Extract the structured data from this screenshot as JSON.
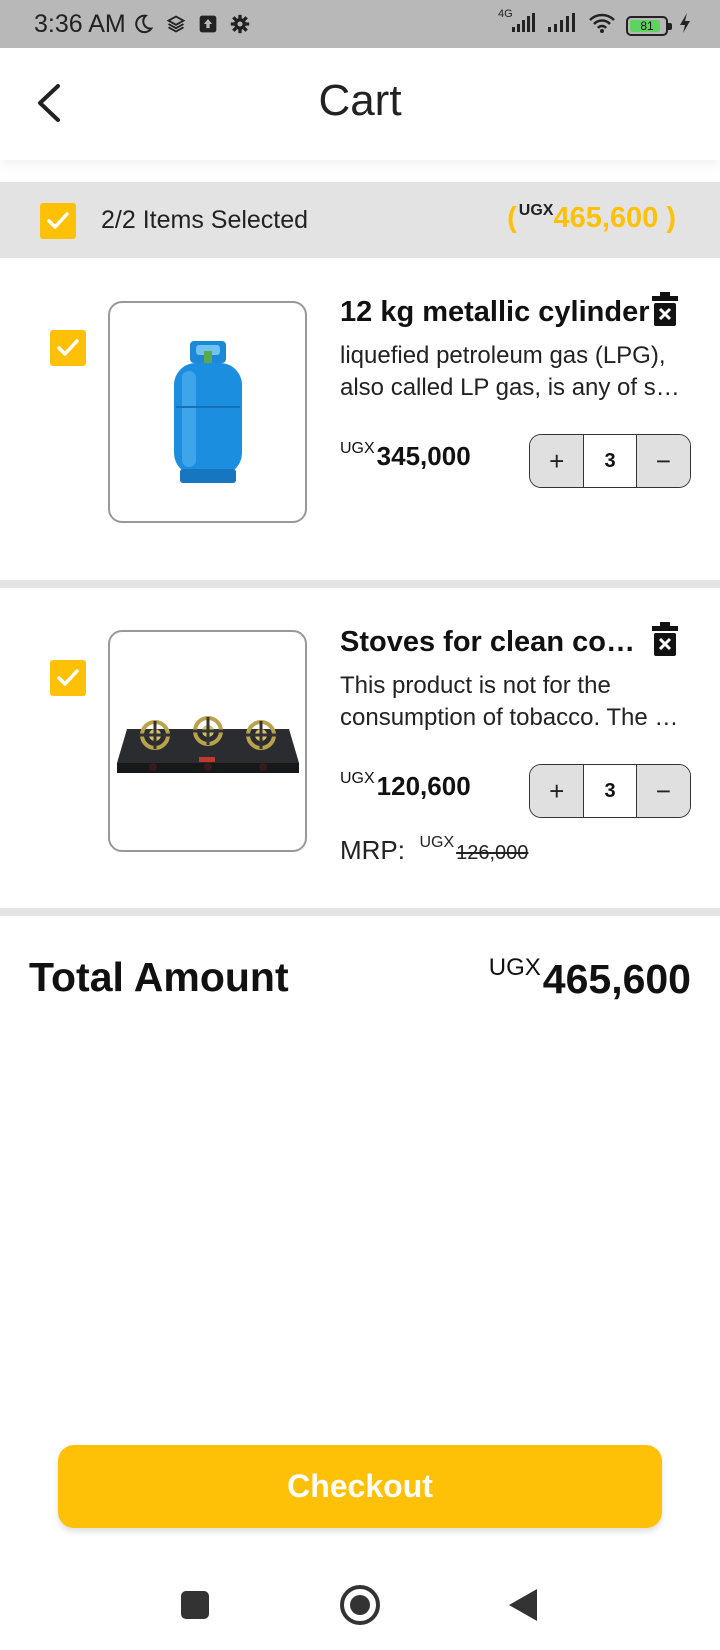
{
  "status_bar": {
    "time": "3:36 AM",
    "network": "4G",
    "battery": "81",
    "icons": [
      "moon-icon",
      "layers-icon",
      "upload-icon",
      "gear-icon",
      "signal-icon",
      "signal-icon",
      "wifi-icon",
      "battery-icon",
      "charging-icon"
    ]
  },
  "header": {
    "title": "Cart",
    "back_icon": "back-arrow-icon"
  },
  "selection": {
    "label": "2/2 Items Selected",
    "open_paren": "(",
    "currency": "UGX",
    "amount": "465,600",
    "close_paren": " )",
    "checked": true
  },
  "items": [
    {
      "name": "12 kg metallic cylinder",
      "desc_line1": "liquefied petroleum gas (LPG),",
      "desc_line2": "also called LP gas, is any of several",
      "currency": "UGX",
      "price": "345,000",
      "qty": "3",
      "plus": "+",
      "minus": "−",
      "checked": true,
      "image": "gas-cylinder-image"
    },
    {
      "name": "Stoves for clean cooking",
      "desc_line1": "This product is not for the",
      "desc_line2": "consumption of tobacco. The product",
      "currency": "UGX",
      "price": "120,600",
      "qty": "3",
      "plus": "+",
      "minus": "−",
      "mrp_label": "MRP:",
      "mrp_currency": "UGX",
      "mrp_value": "126,000",
      "checked": true,
      "image": "gas-stove-image"
    }
  ],
  "total": {
    "label": "Total Amount",
    "currency": "UGX",
    "amount": "465,600"
  },
  "checkout": {
    "label": "Checkout"
  },
  "nav_bar": {
    "icons": [
      "recents-square-icon",
      "home-circle-icon",
      "back-triangle-icon"
    ]
  },
  "colors": {
    "accent": "#ffc107",
    "status_bar": "#b8b8b8",
    "select_bar": "#e3e3e3",
    "stepper_button": "#e0e0e0"
  }
}
